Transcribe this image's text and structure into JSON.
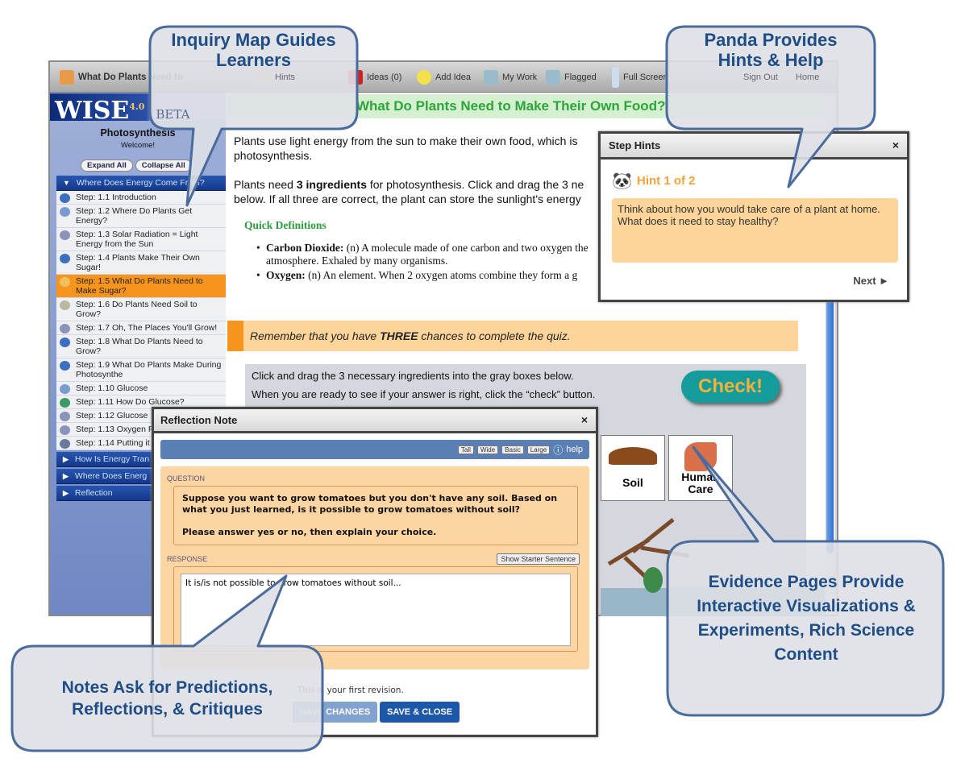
{
  "toolbar": {
    "project": "What Do Plants Need to",
    "items": [
      {
        "label": "Hints",
        "icon": "star-icon"
      },
      {
        "label": "Ideas (0)",
        "icon": "trash-icon"
      },
      {
        "label": "Add Idea",
        "icon": "lightbulb-icon"
      },
      {
        "label": "My Work",
        "icon": "documents-icon"
      },
      {
        "label": "Flagged",
        "icon": "documents-icon"
      },
      {
        "label": "Full Screen",
        "icon": "fullscreen-icon"
      }
    ],
    "right_links": [
      "Sign Out",
      "Home"
    ]
  },
  "logo": {
    "name": "WISE",
    "version": "4.0",
    "tag": "BETA"
  },
  "sidebar": {
    "title": "Photosynthesis",
    "welcome": "Welcome!",
    "expand": "Expand All",
    "collapse": "Collapse All",
    "activity1": "Where Does Energy Come From?",
    "steps": [
      {
        "label": "Step: 1.1 Introduction"
      },
      {
        "label": "Step: 1.2 Where Do Plants Get Energy?"
      },
      {
        "label": "Step: 1.3 Solar Radiation = Light Energy from the Sun"
      },
      {
        "label": "Step: 1.4 Plants Make Their Own Sugar!"
      },
      {
        "label": "Step: 1.5 What Do Plants Need to Make Sugar?",
        "current": true
      },
      {
        "label": "Step: 1.6 Do Plants Need Soil to Grow?"
      },
      {
        "label": "Step: 1.7 Oh, The Places You'll Grow!"
      },
      {
        "label": "Step: 1.8 What Do Plants Need to Grow?"
      },
      {
        "label": "Step: 1.9 What Do Plants Make During Photosynthe"
      },
      {
        "label": "Step: 1.10 Glucose"
      },
      {
        "label": "Step: 1.11 How Do Glucose?"
      },
      {
        "label": "Step: 1.12 Glucose"
      },
      {
        "label": "Step: 1.13 Oxygen Product"
      },
      {
        "label": "Step: 1.14 Putting it"
      }
    ],
    "activities": [
      "How Is Energy Tran",
      "Where Does Energ",
      "Reflection"
    ]
  },
  "content": {
    "title": "What Do Plants Need to Make Their Own Food?",
    "p1": "Plants use light energy from the sun to make their own food, which is photosynthesis.",
    "p2a": "Plants need ",
    "p2b": "3 ingredients",
    "p2c": " for photosynthesis. Click and drag the 3 ne below. If all three are correct, the plant can store the sunlight's energy",
    "quick_definitions": "Quick Definitions",
    "defs": [
      {
        "term": "Carbon Dioxide:",
        "text": " (n) A molecule made of one carbon and two oxygen the atmosphere. Exhaled by many organisms."
      },
      {
        "term": "Oxygen:",
        "text": " (n) An element. When 2 oxygen atoms combine they form a g"
      }
    ],
    "reminder_a": "Remember that you have ",
    "reminder_b": "THREE",
    "reminder_c": " chances to complete the quiz.",
    "instr1": "Click and drag the 3 necessary ingredients into the gray boxes below.",
    "instr2": "When you are ready to see if your answer is right, click the “check” button.",
    "check": "Check!",
    "ingredients": [
      "Soil",
      "Human Care"
    ]
  },
  "hints": {
    "title": "Step Hints",
    "close": "×",
    "heading": "Hint 1 of 2",
    "text": "Think about how you would take care of a plant at home. What does it need to stay healthy?",
    "next": "Next ►"
  },
  "reflection": {
    "title": "Reflection Note",
    "close": "×",
    "sizes": [
      "Tall",
      "Wide",
      "Basic",
      "Large"
    ],
    "help": "help",
    "question_label": "QUESTION",
    "question1": "Suppose you want to grow tomatoes but you don't have any soil. Based on what you just learned, is it possible to grow tomatoes without soil?",
    "question2": "Please answer yes or no, then explain your choice.",
    "response_label": "RESPONSE",
    "starter": "Show Starter Sentence",
    "response": "It is/is not possible to grow tomatoes without soil...",
    "revision": "This is your first revision.",
    "save": "SAVE CHANGES",
    "save_close": "SAVE & CLOSE"
  },
  "callouts": {
    "inquiry": "Inquiry Map Guides Learners",
    "panda": "Panda Provides Hints & Help",
    "evidence": "Evidence Pages Provide Interactive Visualizations & Experiments, Rich Science Content",
    "notes": "Notes Ask for Predictions, Reflections, & Critiques"
  },
  "colors": {
    "accent": "#f7941e",
    "brand": "#1d57a8",
    "callout": "#1f4d86",
    "title_green": "#2da53a"
  }
}
